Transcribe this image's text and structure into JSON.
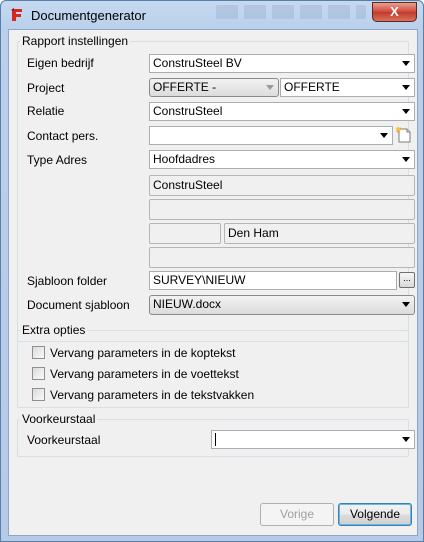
{
  "window": {
    "title": "Documentgenerator",
    "close_label": "X"
  },
  "rapport": {
    "group_title": "Rapport instellingen",
    "eigen_bedrijf": {
      "label": "Eigen bedrijf",
      "value": "ConstruSteel BV"
    },
    "project": {
      "label": "Project",
      "value1": "OFFERTE -",
      "value2": "OFFERTE"
    },
    "relatie": {
      "label": "Relatie",
      "value": "ConstruSteel"
    },
    "contact": {
      "label": "Contact pers.",
      "value": ""
    },
    "type_adres": {
      "label": "Type Adres",
      "value": "Hoofdadres"
    },
    "address": {
      "line1": "ConstruSteel",
      "line2": "",
      "postcode": "",
      "city": "Den Ham",
      "line4": ""
    },
    "sjabloon_folder": {
      "label": "Sjabloon folder",
      "value": "SURVEY\\NIEUW",
      "browse_label": "..."
    },
    "document_sjabloon": {
      "label": "Document sjabloon",
      "value": "NIEUW.docx"
    }
  },
  "extra": {
    "group_title": "Extra opties",
    "options": [
      {
        "label": "Vervang parameters in de koptekst",
        "checked": false
      },
      {
        "label": "Vervang parameters in de voettekst",
        "checked": false
      },
      {
        "label": "Vervang parameters in de tekstvakken",
        "checked": false
      }
    ]
  },
  "voorkeur": {
    "group_title": "Voorkeurstaal",
    "label": "Voorkeurstaal",
    "value": ""
  },
  "buttons": {
    "vorige": "Vorige",
    "volgende": "Volgende"
  },
  "colors": {
    "frame": "#b9cfea",
    "client": "#f0f0f0",
    "close": "#c03a2c",
    "default_button_border": "#3c7fb1"
  }
}
